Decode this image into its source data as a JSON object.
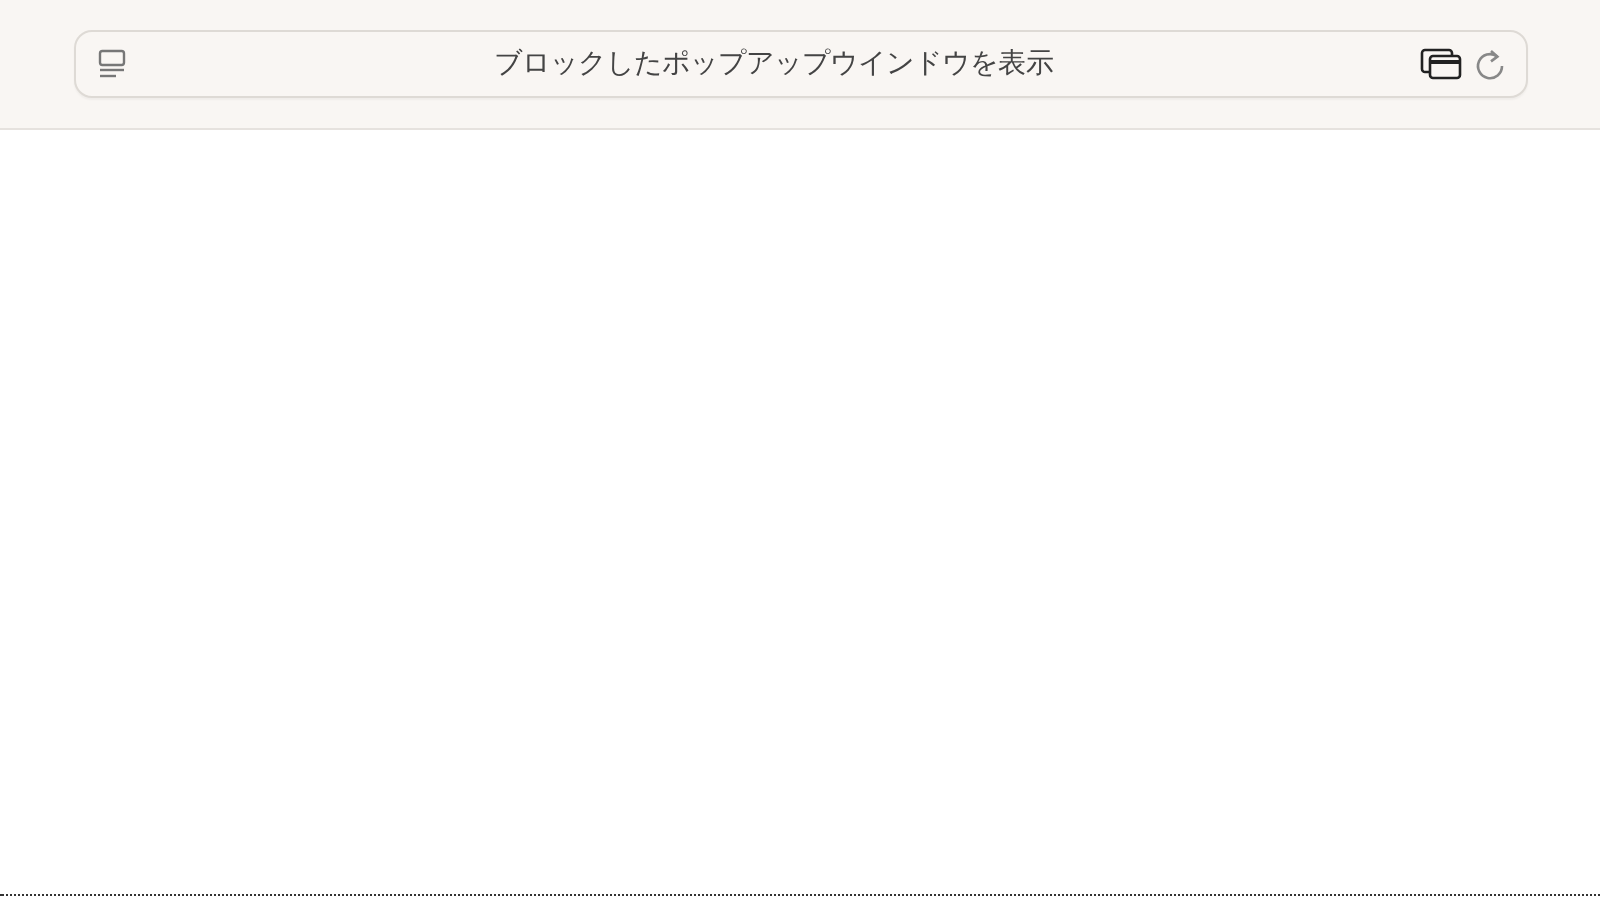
{
  "address_bar": {
    "text": "ブロックしたポップアップウインドウを表示"
  }
}
